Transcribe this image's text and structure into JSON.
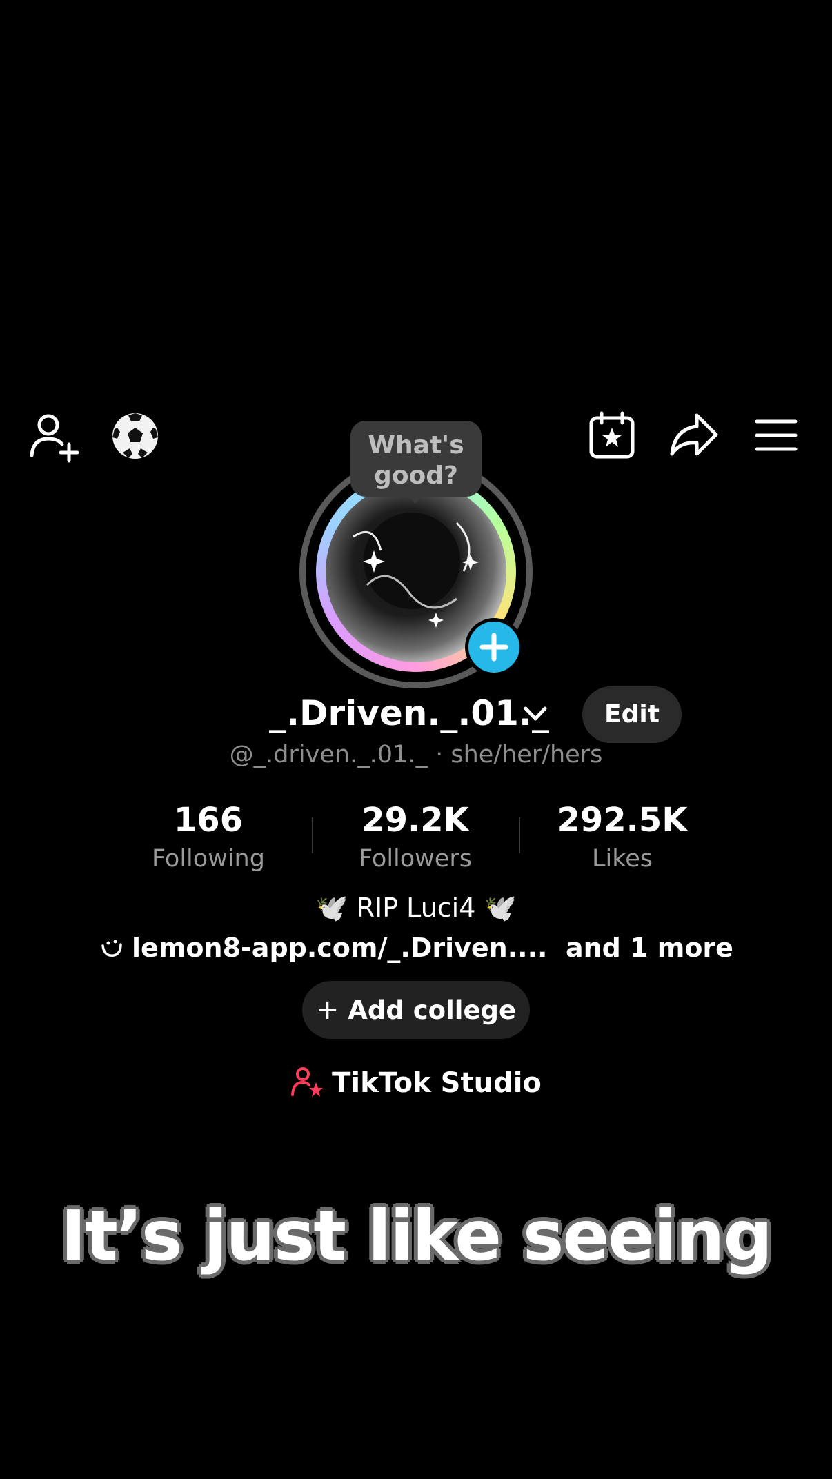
{
  "topbar": {
    "icons": [
      "add-friend-icon",
      "soccer-ball-icon",
      "calendar-star-icon",
      "share-icon",
      "menu-icon"
    ]
  },
  "bubble": {
    "line1": "What's",
    "line2": "good?"
  },
  "profile": {
    "display_name": "_.Driven._.01._",
    "edit_label": "Edit",
    "handle": "@_.driven._.01._",
    "pronouns": "· she/her/hers"
  },
  "stats": [
    {
      "value": "166",
      "label": "Following"
    },
    {
      "value": "29.2K",
      "label": "Followers"
    },
    {
      "value": "292.5K",
      "label": "Likes"
    }
  ],
  "bio": {
    "line": "🕊️ RIP Luci4 🕊️",
    "link": "lemon8-app.com/_.Driven....",
    "link_more": "and 1 more"
  },
  "add_college_label": "Add college",
  "studio_label": "TikTok Studio",
  "caption": "It’s just like seeing",
  "colors": {
    "accent_blue": "#25b8e8",
    "studio_pink": "#ff3b5c"
  }
}
